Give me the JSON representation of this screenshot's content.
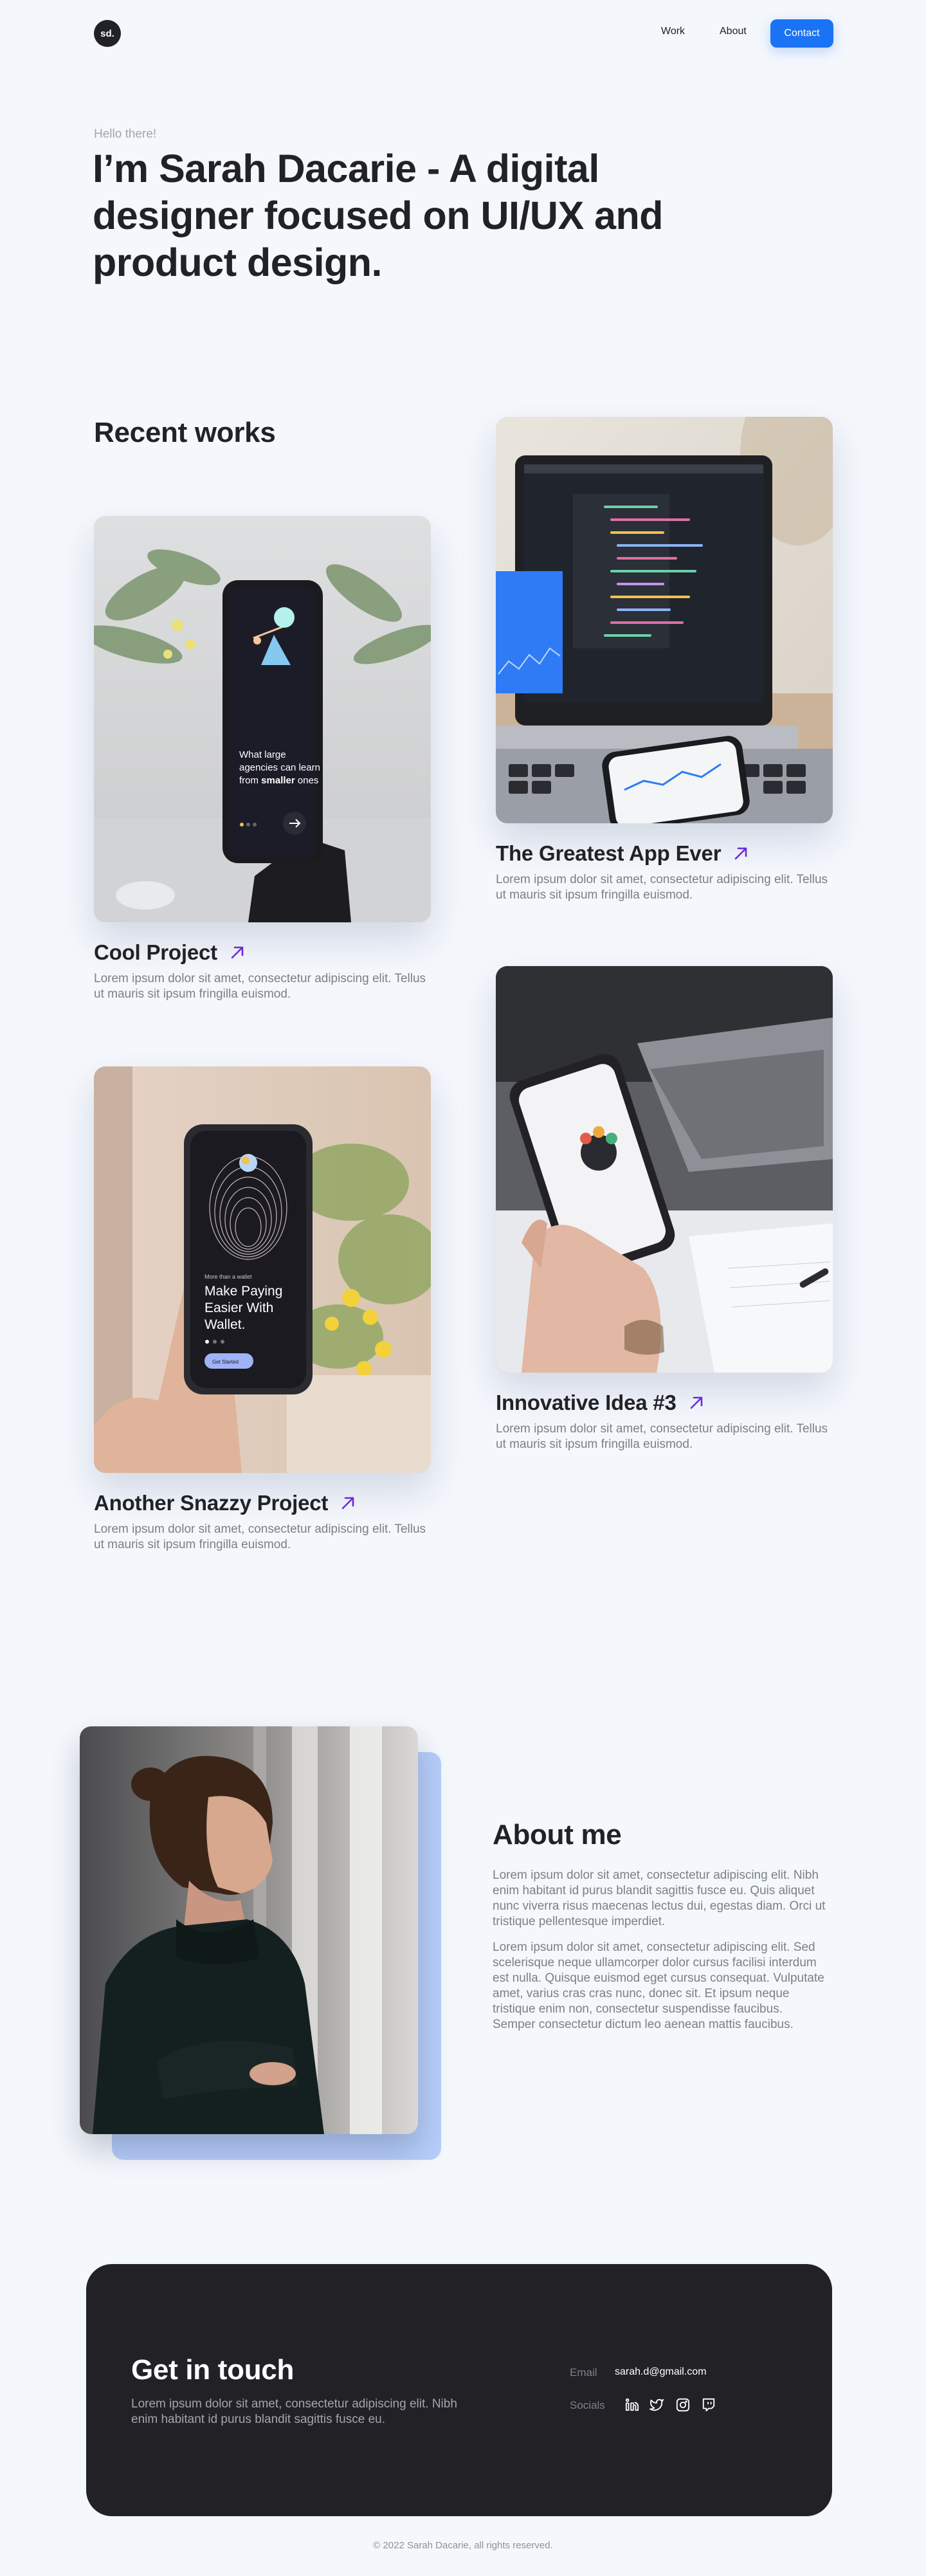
{
  "nav": {
    "logo": "sd.",
    "links": [
      "Work",
      "About"
    ],
    "contact": "Contact"
  },
  "hero": {
    "greeting": "Hello there!",
    "headline": "I’m Sarah Dacarie - A digital designer focused on UI/UX and product design."
  },
  "works": {
    "title": "Recent works",
    "items": [
      {
        "title": "The Greatest App Ever",
        "desc": "Lorem ipsum dolor sit amet, consectetur adipiscing elit. Tellus ut mauris sit ipsum fringilla euismod.",
        "image": "laptop-code-photo"
      },
      {
        "title": "Cool Project",
        "desc": "Lorem ipsum dolor sit amet, consectetur adipiscing elit. Tellus ut mauris sit ipsum fringilla euismod.",
        "image": "phone-on-stand-photo",
        "screen": {
          "line1": "What large",
          "line2": "agencies can learn",
          "line3a": "from ",
          "line3b": "smaller",
          "line3c": " ones"
        }
      },
      {
        "title": "Innovative Idea #3",
        "desc": "Lorem ipsum dolor sit amet, consectetur adipiscing elit. Tellus ut mauris sit ipsum fringilla euismod.",
        "image": "hand-holding-phone-photo"
      },
      {
        "title": "Another Snazzy Project",
        "desc": "Lorem ipsum dolor sit amet, consectetur adipiscing elit. Tellus ut mauris sit ipsum fringilla euismod.",
        "image": "wallet-app-phone-photo",
        "screen": {
          "kicker": "More than a wallet",
          "line1": "Make Paying",
          "line2": "Easier With",
          "line3": "Wallet.",
          "cta": "Get Started"
        }
      }
    ]
  },
  "about": {
    "title": "About me",
    "p1": "Lorem ipsum dolor sit amet, consectetur adipiscing elit. Nibh enim habitant id purus blandit sagittis fusce eu. Quis aliquet nunc viverra risus maecenas lectus dui, egestas diam. Orci ut tristique pellentesque imperdiet.",
    "p2": "Lorem ipsum dolor sit amet, consectetur adipiscing elit. Sed scelerisque neque ullamcorper dolor cursus facilisi interdum est nulla. Quisque euismod eget cursus consequat. Vulputate amet, varius cras cras nunc, donec sit. Et ipsum neque tristique enim non, consectetur suspendisse faucibus. Semper consectetur dictum leo aenean mattis faucibus."
  },
  "contact": {
    "title": "Get in touch",
    "text": "Lorem ipsum dolor sit amet, consectetur adipiscing elit. Nibh enim habitant id purus blandit sagittis fusce eu.",
    "email_label": "Email",
    "email": "sarah.d@gmail.com",
    "socials_label": "Socials",
    "socials": [
      "linkedin-icon",
      "twitter-icon",
      "instagram-icon",
      "twitch-icon"
    ]
  },
  "footer": "© 2022 Sarah Dacarie, all rights reserved.",
  "colors": {
    "background": "#f4f7fc",
    "text": "#222226",
    "accent": "#1a73f5",
    "arrow": "#6c2bd9",
    "dark_panel": "#222226",
    "about_back": "#b6cdf9"
  }
}
